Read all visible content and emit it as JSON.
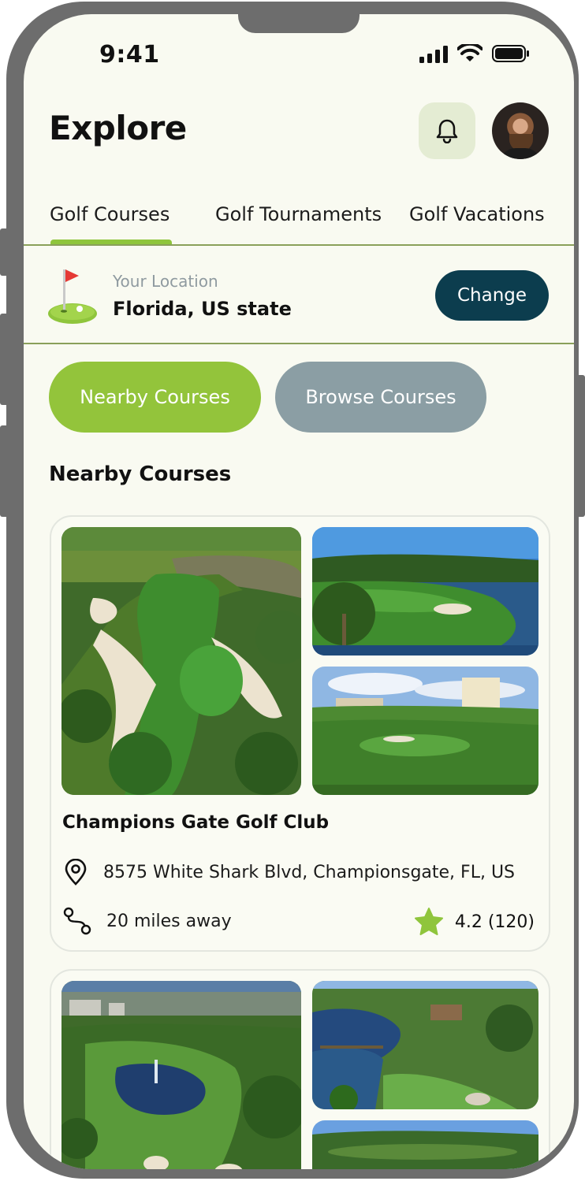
{
  "status_bar": {
    "time": "9:41"
  },
  "header": {
    "title": "Explore"
  },
  "tabs": [
    {
      "label": "Golf Courses",
      "active": true
    },
    {
      "label": "Golf Tournaments",
      "active": false
    },
    {
      "label": "Golf Vacations",
      "active": false
    }
  ],
  "location": {
    "label": "Your Location",
    "value": "Florida, US state",
    "change_label": "Change"
  },
  "filters": {
    "nearby_label": "Nearby Courses",
    "browse_label": "Browse Courses"
  },
  "section_title": "Nearby Courses",
  "courses": [
    {
      "name": "Champions Gate Golf Club",
      "address": "8575 White Shark Blvd, Championsgate, FL, US",
      "distance": "20 miles away",
      "rating": "4.2 (120)"
    }
  ],
  "colors": {
    "accent_green": "#93c43b",
    "dark_teal": "#0c3d4e",
    "inactive_gray": "#8b9ea4",
    "background": "#f9faf1"
  }
}
